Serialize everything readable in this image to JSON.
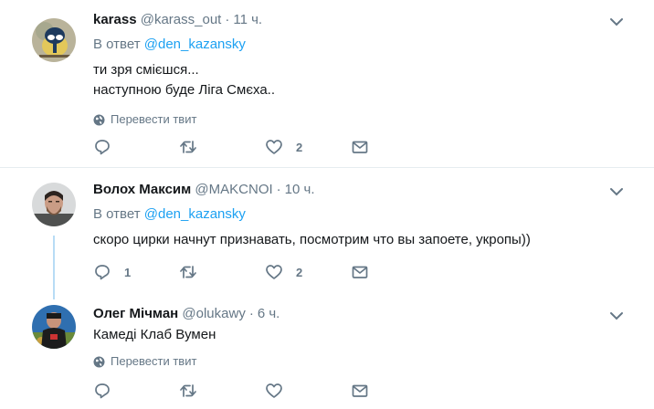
{
  "tweets": [
    {
      "name": "karass",
      "handle": "@karass_out",
      "separator": "·",
      "time": "11 ч.",
      "reply_prefix": "В ответ",
      "reply_to": "@den_kazansky",
      "text_lines": [
        "ти зря смієшся...",
        "наступною буде Ліга Смєха.."
      ],
      "translate": "Перевести твит",
      "counts": {
        "reply": "",
        "retweet": "",
        "like": "2"
      }
    },
    {
      "name": "Волох Максим",
      "handle": "@MAKCNOI",
      "separator": "·",
      "time": "10 ч.",
      "reply_prefix": "В ответ",
      "reply_to": "@den_kazansky",
      "text_lines": [
        "скоро цирки начнут признавать, посмотрим что вы запоете, укропы))"
      ],
      "counts": {
        "reply": "1",
        "retweet": "",
        "like": "2"
      }
    },
    {
      "name": "Олег Мічман",
      "handle": "@olukawy",
      "separator": "·",
      "time": "6 ч.",
      "text_lines": [
        "Камеді Клаб Вумен"
      ],
      "translate": "Перевести твит",
      "counts": {
        "reply": "",
        "retweet": "",
        "like": ""
      }
    }
  ],
  "colors": {
    "accent": "#1da1f2",
    "muted": "#657786",
    "thread_line": "#b8dcf5",
    "divider": "#e6ecf0"
  },
  "icons": [
    "chevron-down-icon",
    "globe-icon",
    "reply-icon",
    "retweet-icon",
    "like-icon",
    "message-icon"
  ]
}
